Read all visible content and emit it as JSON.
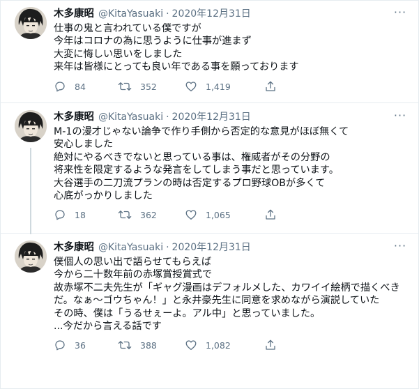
{
  "tweets": [
    {
      "author": {
        "name": "木多康昭",
        "handle": "@KitaYasuaki"
      },
      "date": "2020年12月31日",
      "text": "仕事の鬼と言われている僕ですが\n今年はコロナの為に思うように仕事が進まず\n大変に悔しい思いをしました\n来年は皆様にとっても良い年である事を願っております",
      "replies": "84",
      "retweets": "352",
      "likes": "1,419",
      "more": "···"
    },
    {
      "author": {
        "name": "木多康昭",
        "handle": "@KitaYasuaki"
      },
      "date": "2020年12月31日",
      "text": "M-1の漫才じゃない論争で作り手側から否定的な意見がほぼ無くて\n安心しました\n絶対にやるべきでないと思っている事は、権威者がその分野の\n将来性を限定するような発言をしてしまう事だと思っています。\n大谷選手の二刀流プランの時は否定するプロ野球OBが多くて\n心底がっかりしました",
      "replies": "18",
      "retweets": "362",
      "likes": "1,065",
      "more": "···"
    },
    {
      "author": {
        "name": "木多康昭",
        "handle": "@KitaYasuaki"
      },
      "date": "2020年12月31日",
      "text": "僕個人の思い出で語らせてもらえば\n今から二十数年前の赤塚賞授賞式で\n故赤塚不二夫先生が「ギャグ漫画はデフォルメした、カワイイ絵柄で描くべきだ。なぁ～ゴウちゃん！」と永井豪先生に同意を求めながら演説していた\nその時、僕は「うるせぇーよ。アル中」と思っていました。\n...今だから言える話です",
      "replies": "36",
      "retweets": "388",
      "likes": "1,082",
      "more": "···"
    }
  ],
  "icons": {
    "reply": "reply-icon",
    "retweet": "retweet-icon",
    "like": "heart-icon",
    "share": "share-icon",
    "more": "more-icon"
  },
  "colors": {
    "text": "#0f1419",
    "secondary": "#5b7083",
    "divider": "#e6ecf0",
    "thread_line": "#cfd9de"
  }
}
